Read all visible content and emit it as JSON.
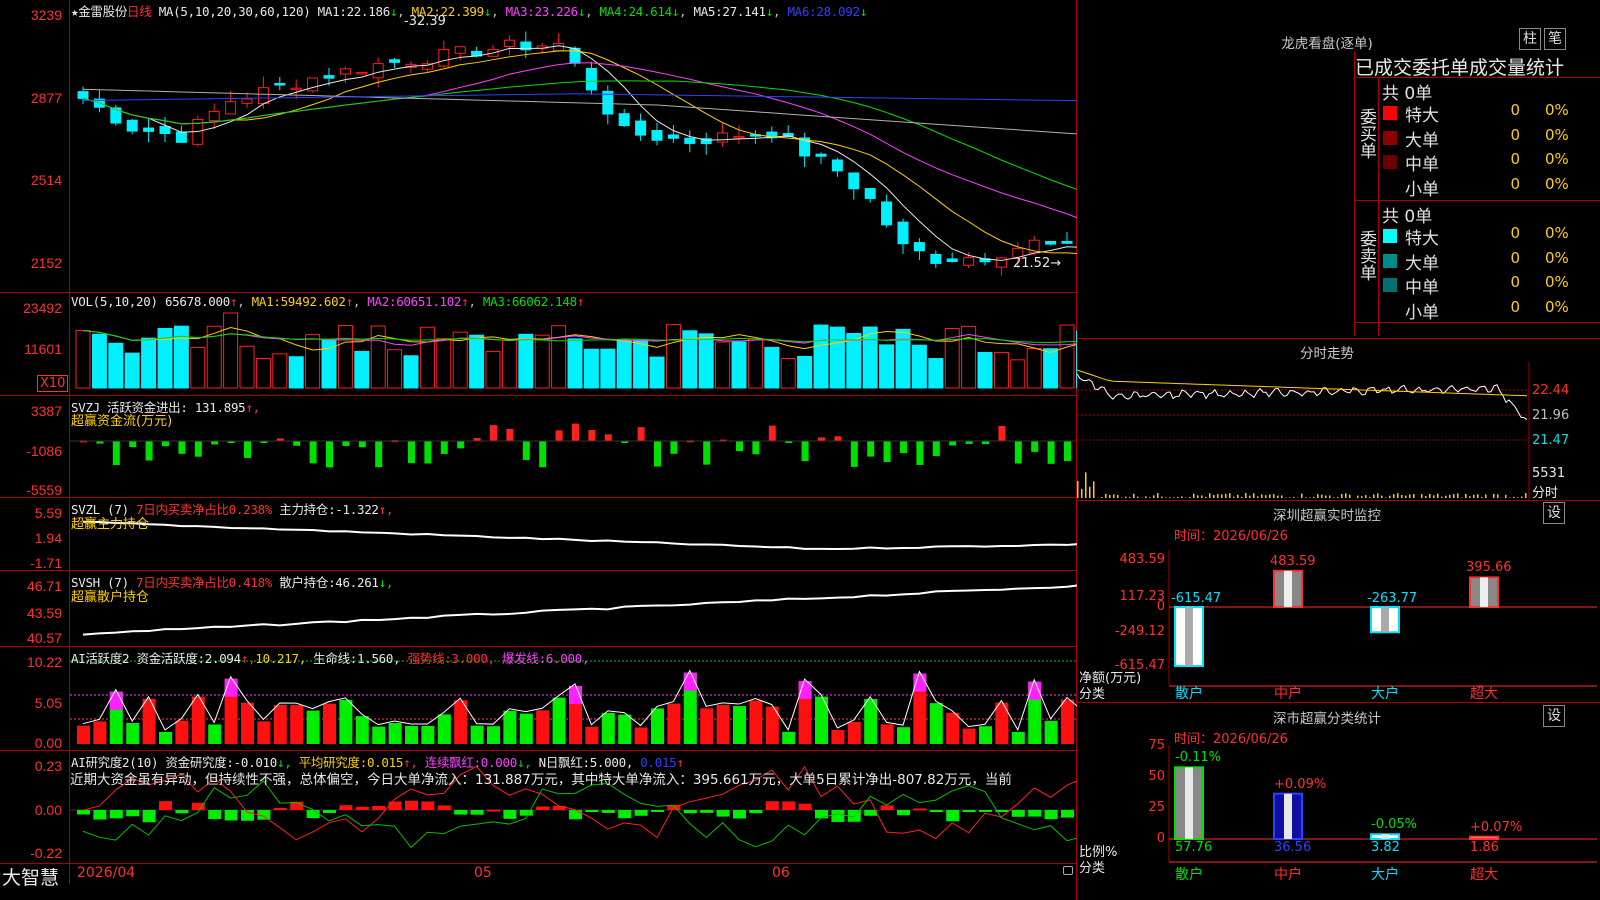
{
  "colors": {
    "up": "#ff2020",
    "down": "#00f0ff",
    "frame": "#aa0000",
    "ma1": "#e8e8e8",
    "ma2": "#ffd000",
    "ma3": "#ff40ff",
    "ma4": "#00e000",
    "ma5": "#b0b0b0",
    "ma6": "#3040ff"
  },
  "kline": {
    "star": "★",
    "stock_name": "金雷股份",
    "period": "日线",
    "ma_params": "MA(5,10,20,30,60,120)",
    "ma1_label": "MA1:",
    "ma1_val": "22.186",
    "ma1_arrow": "↓",
    "ma2_label": "MA2:",
    "ma2_val": "22.399",
    "ma2_arrow": "↓",
    "ma3_label": "MA3:",
    "ma3_val": "23.226",
    "ma3_arrow": "↓",
    "ma4_label": "MA4:",
    "ma4_val": "24.614",
    "ma4_arrow": "↓",
    "ma5_label": "MA5:",
    "ma5_val": "27.141",
    "ma5_arrow": "↓",
    "ma6_label": "MA6:",
    "ma6_val": "28.092",
    "ma6_arrow": "↓",
    "y_ticks": [
      "3239",
      "2877",
      "2514",
      "2152"
    ],
    "high_mark": "32.39",
    "low_mark": "21.52"
  },
  "volume": {
    "params": "VOL(5,10,20)",
    "value": "65678.000",
    "value_arrow": "↑",
    "ma1_label": "MA1:",
    "ma1_val": "59492.602",
    "ma1_arrow": "↑",
    "ma2_label": "MA2:",
    "ma2_val": "60651.102",
    "ma2_arrow": "↑",
    "ma3_label": "MA3:",
    "ma3_val": "66062.148",
    "ma3_arrow": "↑",
    "y_ticks": [
      "23492",
      "11601"
    ],
    "unit": "X10"
  },
  "svzj": {
    "name": "SVZJ",
    "label": "活跃资金进出:",
    "value": "131.895",
    "arrow": "↑,",
    "subtitle": "超赢资金流(万元)",
    "y_ticks": [
      "3387",
      "-1086",
      "-5559"
    ]
  },
  "svzl": {
    "name": "SVZL (7)",
    "l1": "7日内买卖净占比0.238%",
    "l2": "主力持仓:",
    "value": "-1.322",
    "arrow": "↑,",
    "subtitle": "超赢主力持仓",
    "y_ticks": [
      "5.59",
      "1.94",
      "-1.71"
    ]
  },
  "svsh": {
    "name": "SVSH (7)",
    "l1": "7日内买卖净占比0.418%",
    "l2": "散户持仓:",
    "value": "46.261",
    "arrow": "↓,",
    "subtitle": "超赢散户持仓",
    "y_ticks": [
      "46.71",
      "43.59",
      "40.57"
    ]
  },
  "ai_active": {
    "name": "AI活跃度2",
    "l1": "资金活跃度:",
    "v1": "2.094",
    "a1": "↑,",
    "v2": "10.217,",
    "l3": "生命线:",
    "v3": "1.560,",
    "l4": "强势线:",
    "v4": "3.000,",
    "l5": "爆发线:",
    "v5": "6.000,",
    "y_ticks": [
      "10.22",
      "5.05",
      "0.00"
    ]
  },
  "ai_research": {
    "name": "AI研究度2(10)",
    "l1": "资金研究度:",
    "v1": "-0.010",
    "a1": "↓,",
    "l2": "平均研究度:",
    "v2": "0.015",
    "a2": "↑,",
    "l3": "连续飘红:",
    "v3": "0.000",
    "a3": "↓,",
    "l4": "N日飘红:",
    "v4": "5.000,",
    "v5": "0.015",
    "a5": "↑",
    "commentary": "近期大资金虽有异动，但持续性不强，总体偏空，今日大单净流入：131.887万元，其中特大单净流入：395.661万元，大单5日累计净出-807.82万元，当前",
    "y_ticks": [
      "0.23",
      "0.00",
      "-0.22"
    ]
  },
  "xaxis": {
    "start": "2026/04",
    "m5": "05",
    "m6": "06"
  },
  "brand": "大智慧",
  "lhb": {
    "title": "龙虎看盘(逐单)",
    "btn1": "柱",
    "btn2": "笔",
    "subtitle": "已成交委托单成交量统计",
    "buy_label": "委买单",
    "buy_total": "共 0单",
    "buy_rows": [
      {
        "name": "特大",
        "num": "0",
        "pct": "0%",
        "color": "#ff0000"
      },
      {
        "name": "大单",
        "num": "0",
        "pct": "0%",
        "color": "#8b0000"
      },
      {
        "name": "中单",
        "num": "0",
        "pct": "0%",
        "color": "#6b0000"
      },
      {
        "name": "小单",
        "num": "0",
        "pct": "0%",
        "color": "#000000"
      }
    ],
    "sell_label": "委卖单",
    "sell_total": "共 0单",
    "sell_rows": [
      {
        "name": "特大",
        "num": "0",
        "pct": "0%",
        "color": "#00ffff"
      },
      {
        "name": "大单",
        "num": "0",
        "pct": "0%",
        "color": "#008b8b"
      },
      {
        "name": "中单",
        "num": "0",
        "pct": "0%",
        "color": "#007070"
      },
      {
        "name": "小单",
        "num": "0",
        "pct": "0%",
        "color": "#000000"
      }
    ]
  },
  "minute": {
    "title": "分时走势",
    "y_ticks": [
      "22.44",
      "21.96",
      "21.47"
    ],
    "vol": "5531",
    "vol_unit": "分时"
  },
  "sz_monitor": {
    "title": "深圳超赢实时监控",
    "btn": "设",
    "time_label": "时间：",
    "time": "2026/06/26",
    "y_ticks": [
      "483.59",
      "117.23",
      "0",
      "-249.12",
      "-615.47"
    ],
    "ylabel": "净额(万元)",
    "xlabel": "分类",
    "categories": [
      "散户",
      "中户",
      "大户",
      "超大"
    ],
    "values": [
      -615.47,
      483.59,
      -263.77,
      395.66
    ],
    "labels": [
      "-615.47",
      "483.59",
      "-263.77",
      "395.66"
    ]
  },
  "sz_class": {
    "title": "深市超赢分类统计",
    "btn": "设",
    "time_label": "时间：",
    "time": "2026/06/26",
    "y_ticks": [
      "75",
      "50",
      "25",
      "0"
    ],
    "ylabel": "比例%",
    "xlabel": "分类",
    "categories": [
      "散户",
      "中户",
      "大户",
      "超大"
    ],
    "values": [
      57.76,
      36.56,
      3.82,
      1.86
    ],
    "changes": [
      "-0.11%",
      "+0.09%",
      "-0.05%",
      "+0.07%"
    ],
    "value_labels": [
      "57.76",
      "36.56",
      "3.82",
      "1.86"
    ]
  }
}
